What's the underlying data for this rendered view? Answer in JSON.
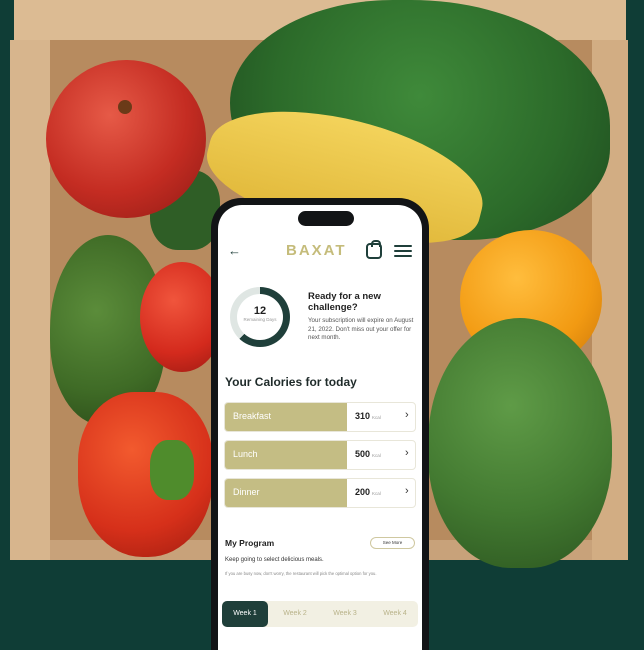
{
  "app": {
    "brand": "BAXAT"
  },
  "subscription": {
    "remaining_count": "12",
    "remaining_label": "Remaining Days",
    "progress_fraction": 0.62,
    "title": "Ready for a new challenge?",
    "body": "Your subscription will expire on August 21, 2022. Don't miss out your offer for next month."
  },
  "calories": {
    "title": "Your Calories for today",
    "unit": "Kcal",
    "rows": [
      {
        "label": "Breakfast",
        "value": "310"
      },
      {
        "label": "Lunch",
        "value": "500"
      },
      {
        "label": "Dinner",
        "value": "200"
      }
    ]
  },
  "program": {
    "title": "My Program",
    "see_more": "See More",
    "description": "Keep going to select delicious meals.",
    "note": "If you are busy now, don't worry, the restaurant will pick the optimal option for you.",
    "weeks": [
      "Week 1",
      "Week 2",
      "Week 3",
      "Week 4"
    ],
    "active_week": "Week 1"
  },
  "colors": {
    "background": "#0f3d36",
    "primary": "#1f3f3a",
    "accent": "#c4bd84"
  }
}
